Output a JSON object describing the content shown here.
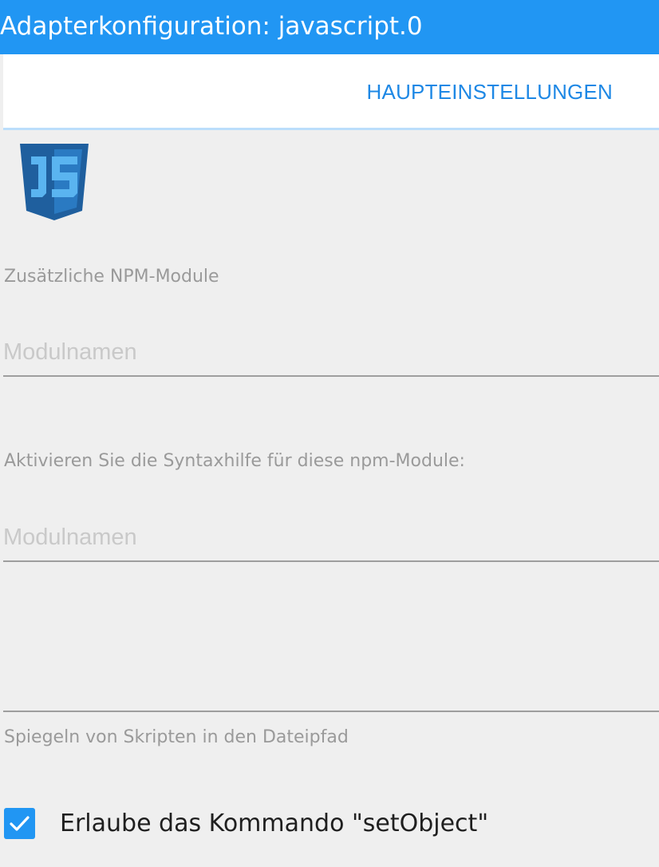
{
  "window": {
    "title": "Adapterkonfiguration: javascript.0"
  },
  "tabs": [
    {
      "label": "HAUPTEINSTELLUNGEN"
    }
  ],
  "logo": {
    "icon": "javascript-logo-icon",
    "text": "JS",
    "color": "#1f5f9e"
  },
  "settings": {
    "npm_modules": {
      "label": "Zusätzliche NPM-Module",
      "placeholder": "Modulnamen",
      "value": ""
    },
    "syntax_help": {
      "label": "Aktivieren Sie die Syntaxhilfe für diese npm-Module:",
      "placeholder": "Modulnamen",
      "value": ""
    },
    "mirror_path": {
      "label": "Spiegeln von Skripten in den Dateipfad",
      "value": ""
    },
    "allow_set_object": {
      "label": "Erlaube das Kommando \"setObject\"",
      "checked": true
    }
  },
  "colors": {
    "accent": "#2196f3",
    "tab_text": "#1e88e5",
    "background": "#efefef"
  }
}
